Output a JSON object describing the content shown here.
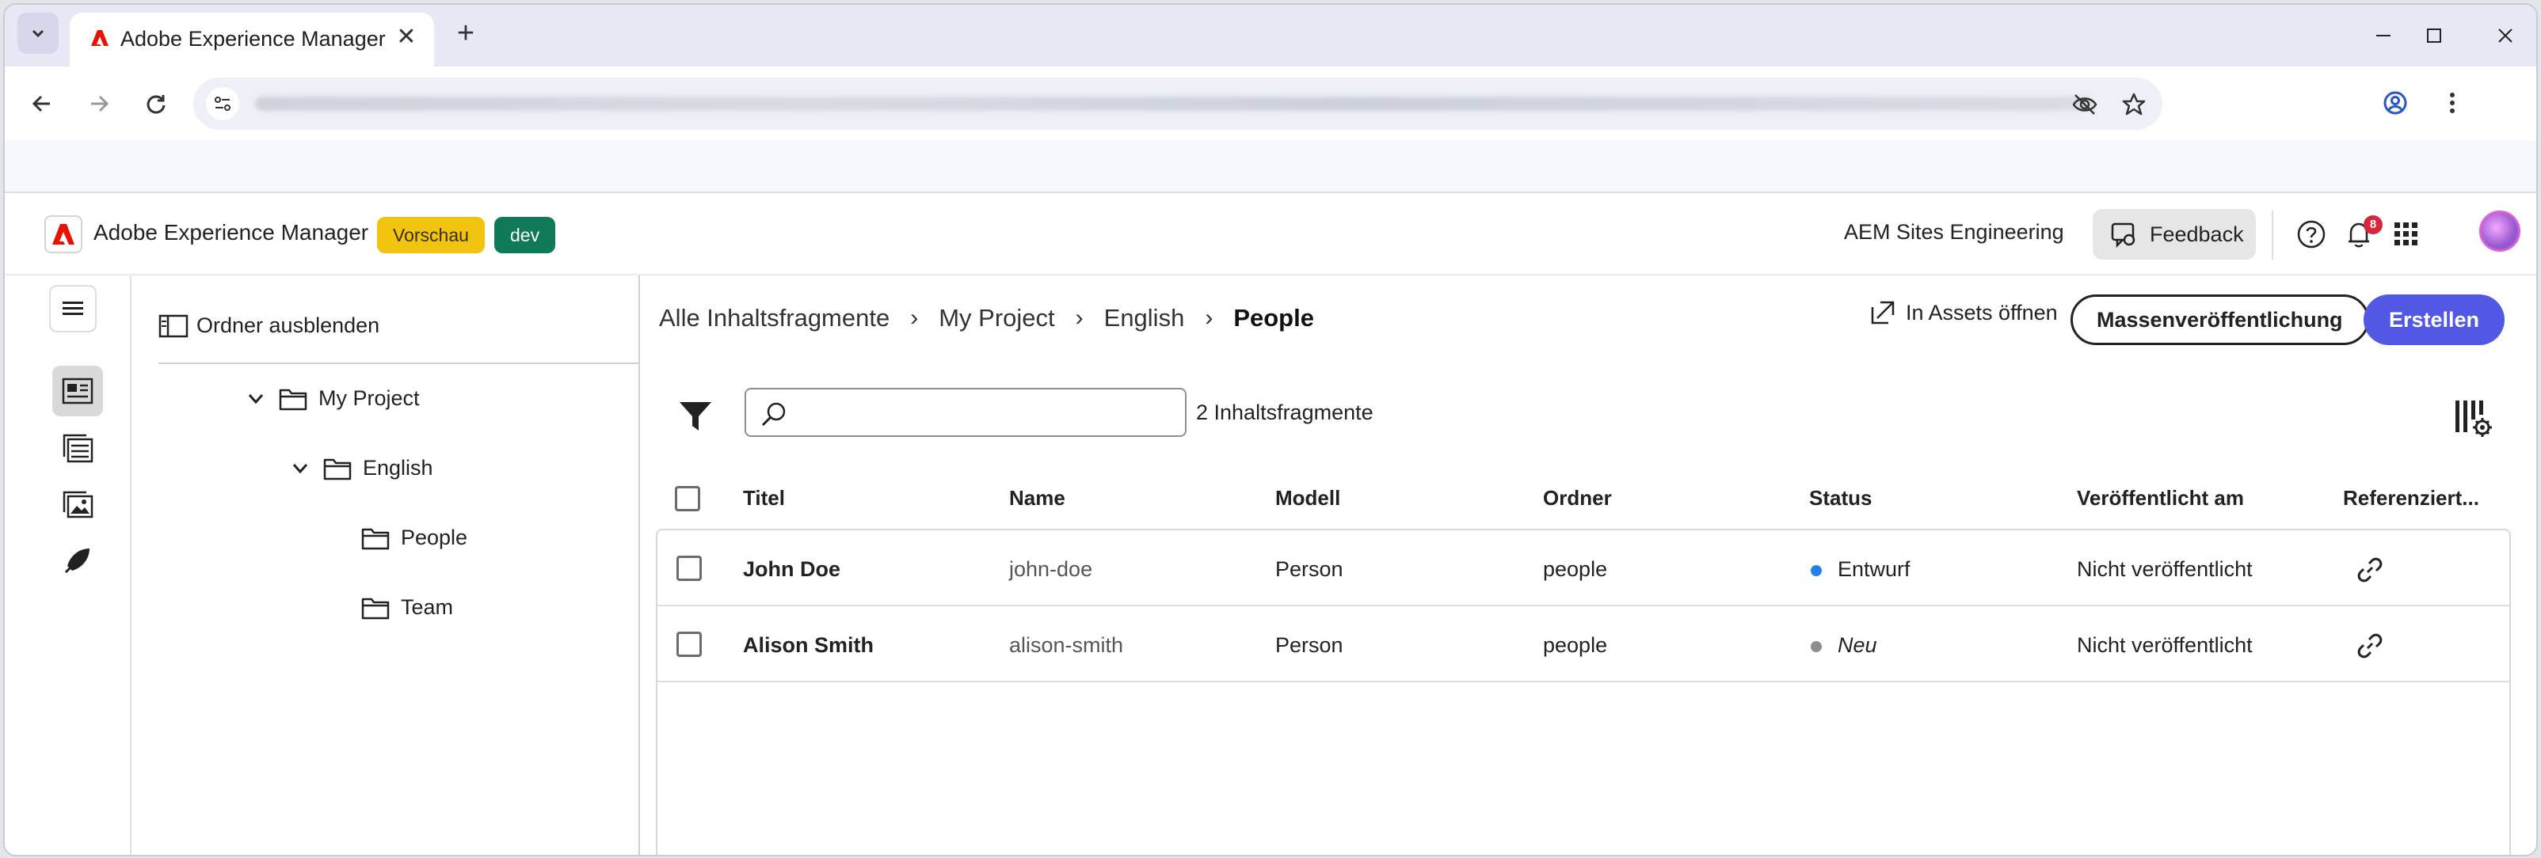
{
  "browser": {
    "tab_title": "Adobe Experience Manager",
    "colors": {
      "accent": "#5258e4",
      "adobe_red": "#eb1000"
    }
  },
  "header": {
    "app_title": "Adobe Experience Manager",
    "badge_preview": "Vorschau",
    "badge_dev": "dev",
    "org_name": "AEM Sites Engineering",
    "feedback_label": "Feedback",
    "notification_count": "8"
  },
  "rail": {
    "items": [
      {
        "icon": "content-fragments-icon",
        "active": true
      },
      {
        "icon": "models-icon",
        "active": false
      },
      {
        "icon": "assets-icon",
        "active": false
      },
      {
        "icon": "launch-icon",
        "active": false
      }
    ]
  },
  "tree": {
    "hide_label": "Ordner ausblenden",
    "nodes": [
      {
        "label": "My Project",
        "expanded": true
      },
      {
        "label": "English",
        "expanded": true
      },
      {
        "label": "People"
      },
      {
        "label": "Team"
      }
    ]
  },
  "breadcrumb": {
    "items": [
      "Alle Inhaltsfragmente",
      "My Project",
      "English",
      "People"
    ]
  },
  "actions": {
    "open_assets": "In Assets öffnen",
    "bulk_publish": "Massenveröffentlichung",
    "create": "Erstellen"
  },
  "search": {
    "placeholder": "",
    "count_label": "2 Inhaltsfragmente"
  },
  "table": {
    "columns": [
      "Titel",
      "Name",
      "Modell",
      "Ordner",
      "Status",
      "Veröffentlicht am",
      "Referenziert..."
    ],
    "rows": [
      {
        "title": "John Doe",
        "name": "john-doe",
        "model": "Person",
        "folder": "people",
        "status": "Entwurf",
        "status_color": "#2680eb",
        "published": "Nicht veröffentlicht"
      },
      {
        "title": "Alison Smith",
        "name": "alison-smith",
        "model": "Person",
        "folder": "people",
        "status": "Neu",
        "status_color": "#8e8e8e",
        "published": "Nicht veröffentlicht"
      }
    ]
  }
}
